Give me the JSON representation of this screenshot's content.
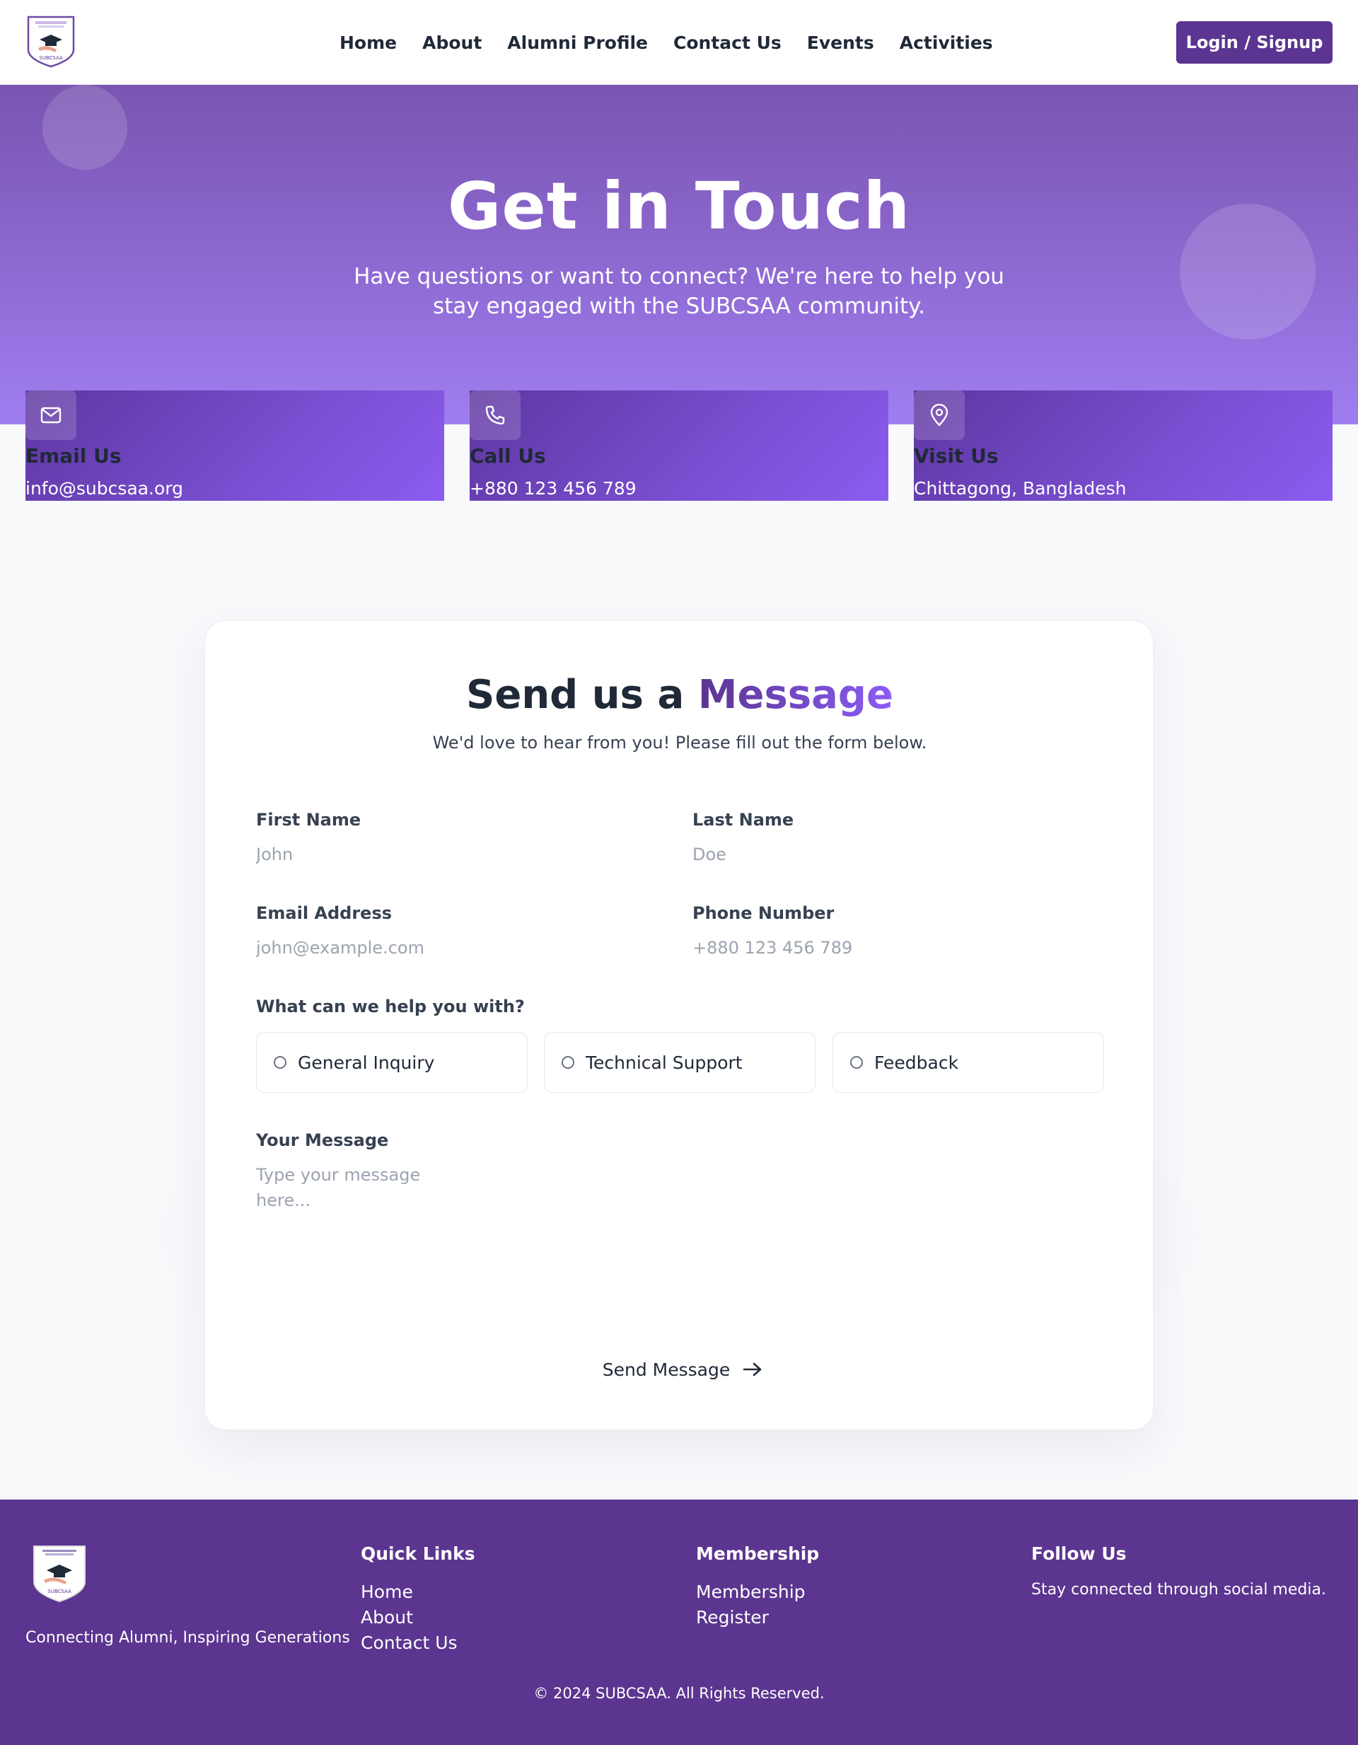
{
  "nav": {
    "logo_text": "SUBCSAA",
    "links": [
      "Home",
      "About",
      "Alumni Profile",
      "Contact Us",
      "Events",
      "Activities"
    ],
    "login_label": "Login / Signup"
  },
  "hero": {
    "title": "Get in Touch",
    "subtitle": "Have questions or want to connect? We're here to help you stay engaged with the SUBCSAA community."
  },
  "contact_cards": [
    {
      "icon": "mail-icon",
      "title": "Email Us",
      "value": "info@subcsaa.org"
    },
    {
      "icon": "phone-icon",
      "title": "Call Us",
      "value": "+880 123 456 789"
    },
    {
      "icon": "map-pin-icon",
      "title": "Visit Us",
      "value": "Chittagong, Bangladesh"
    }
  ],
  "form": {
    "title_plain": "Send us a ",
    "title_accent": "Message",
    "subtitle": "We'd love to hear from you! Please fill out the form below.",
    "first_name": {
      "label": "First Name",
      "placeholder": "John"
    },
    "last_name": {
      "label": "Last Name",
      "placeholder": "Doe"
    },
    "email": {
      "label": "Email Address",
      "placeholder": "john@example.com"
    },
    "phone": {
      "label": "Phone Number",
      "placeholder": "+880 123 456 789"
    },
    "help_label": "What can we help you with?",
    "options": [
      "General Inquiry",
      "Technical Support",
      "Feedback"
    ],
    "message": {
      "label": "Your Message",
      "placeholder": "Type your message here..."
    },
    "send_label": "Send Message"
  },
  "footer": {
    "tagline": "Connecting Alumni, Inspiring Generations",
    "quick_links_heading": "Quick Links",
    "quick_links": [
      "Home",
      "About",
      "Contact Us"
    ],
    "membership_heading": "Membership",
    "membership_links": [
      "Membership",
      "Register"
    ],
    "follow_heading": "Follow Us",
    "follow_text": "Stay connected through social media.",
    "copyright": "© 2024 SUBCSAA. All Rights Reserved."
  },
  "colors": {
    "brand": "#5b3591",
    "accent": "#8b5cf6",
    "footer_bg": "#5b358f"
  }
}
